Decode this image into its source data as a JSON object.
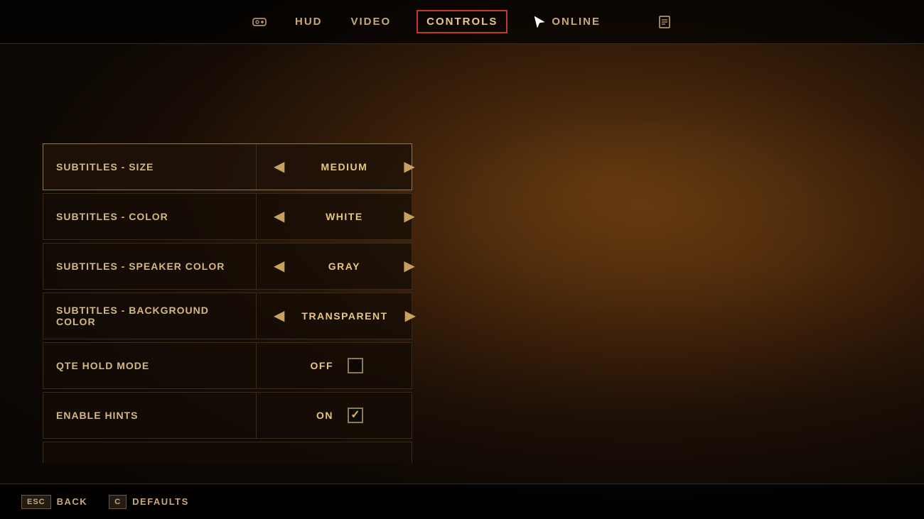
{
  "nav": {
    "tabs": [
      {
        "id": "game-icon",
        "icon": "🎮",
        "label": "GAME"
      },
      {
        "id": "hud-tab",
        "label": "HUD"
      },
      {
        "id": "video-tab",
        "label": "VIDEO"
      },
      {
        "id": "controls-tab",
        "label": "CONTROLS"
      },
      {
        "id": "online-tab",
        "label": "ONLINE"
      },
      {
        "id": "extra-icon",
        "icon": "📋"
      }
    ]
  },
  "settings": {
    "rows": [
      {
        "id": "subtitles-size",
        "label": "Subtitles - Size",
        "type": "selector",
        "value": "Medium",
        "active": true
      },
      {
        "id": "subtitles-color",
        "label": "Subtitles - Color",
        "type": "selector",
        "value": "White",
        "active": false
      },
      {
        "id": "subtitles-speaker-color",
        "label": "Subtitles - Speaker Color",
        "type": "selector",
        "value": "Gray",
        "active": false
      },
      {
        "id": "subtitles-bg-color",
        "label": "Subtitles - Background Color",
        "type": "selector",
        "value": "Transparent",
        "active": false
      },
      {
        "id": "qte-hold-mode",
        "label": "QTE Hold Mode",
        "type": "checkbox",
        "value": "Off",
        "checked": false
      },
      {
        "id": "enable-hints",
        "label": "Enable Hints",
        "type": "checkbox",
        "value": "On",
        "checked": true
      }
    ]
  },
  "bottombar": {
    "back_key": "ESC",
    "back_label": "Back",
    "defaults_key": "C",
    "defaults_label": "Defaults"
  }
}
